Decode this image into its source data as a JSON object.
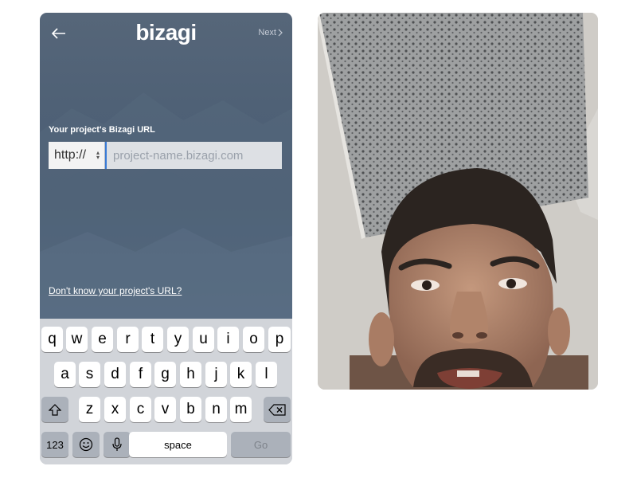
{
  "app": {
    "logo_text": "bizagi",
    "next_label": "Next",
    "back_icon": "arrow-left-icon",
    "url_label": "Your project's Bizagi URL",
    "protocol_value": "http://",
    "url_placeholder": "project-name.bizagi.com",
    "help_link": "Don't know your project's URL?"
  },
  "keyboard": {
    "row1": [
      "q",
      "w",
      "e",
      "r",
      "t",
      "y",
      "u",
      "i",
      "o",
      "p"
    ],
    "row2": [
      "a",
      "s",
      "d",
      "f",
      "g",
      "h",
      "j",
      "k",
      "l"
    ],
    "row3": [
      "z",
      "x",
      "c",
      "v",
      "b",
      "n",
      "m"
    ],
    "shift_icon": "shift-icon",
    "delete_icon": "backspace-icon",
    "numbers_label": "123",
    "emoji_icon": "emoji-icon",
    "mic_icon": "microphone-icon",
    "space_label": "space",
    "go_label": "Go"
  },
  "video": {
    "description_icon": "camera-feed"
  },
  "colors": {
    "app_bg": "#4f6176",
    "keyboard_bg": "#d1d4d9",
    "cursor": "#3a7bd5"
  }
}
